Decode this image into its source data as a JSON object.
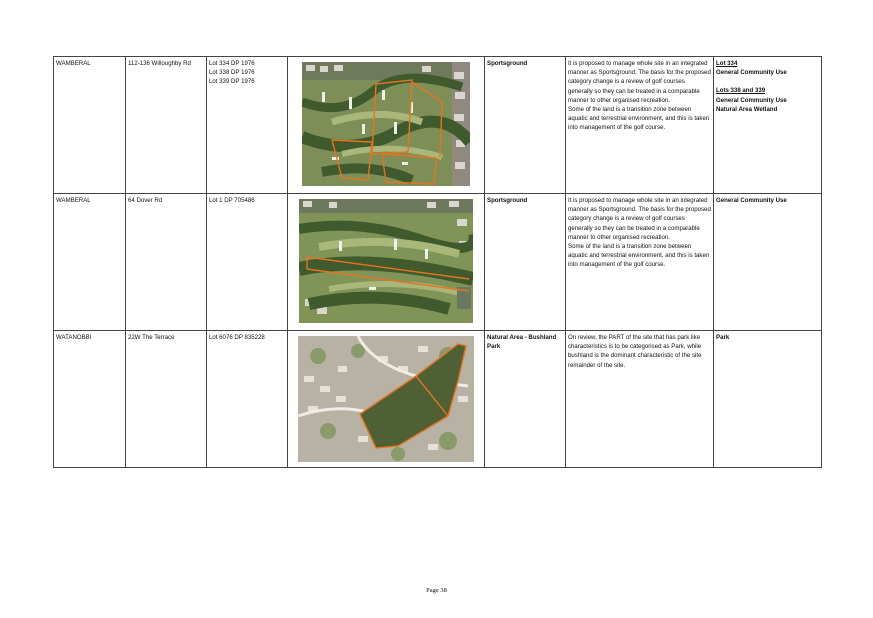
{
  "rows": [
    {
      "locality": "WAMBERAL",
      "address": "112-136 Willoughby Rd",
      "lots": [
        "Lot 334 DP 1976",
        "Lot 338 DP 1976",
        "Lot 339 DP 1976"
      ],
      "proposed_category": "Sportsground",
      "comment": "It is proposed to manage whole site in an integrated manner as Sportsground. The basis for the proposed category change is a review of golf courses generally so they can be treated in a comparable manner to other organised recreation.",
      "comment2": "Some of the land is a transition zone between aquatic and terrestrial environment, and this is taken into management of the golf course.",
      "category_groups": [
        {
          "heading": "Lot 334",
          "items": [
            "General Community Use"
          ]
        },
        {
          "heading": "Lots 338 and 339",
          "items": [
            "General Community Use",
            "Natural Area Wetland"
          ]
        }
      ]
    },
    {
      "locality": "WAMBERAL",
      "address": "64 Dover Rd",
      "lots": [
        "Lot 1 DP 705486"
      ],
      "proposed_category": "Sportsground",
      "comment": "It is proposed to manage whole site in an integrated manner as Sportsground. The basis for the proposed category change is a review of golf courses generally so they can be treated in a comparable manner to other organised recreation.",
      "comment2": "Some of the land is a transition zone between aquatic and terrestrial environment, and this is taken into management of the golf course.",
      "category": "General Community Use"
    },
    {
      "locality": "WATANOBBI",
      "address": "22W The Terrace",
      "lots": [
        "Lot 6076 DP 835228"
      ],
      "proposed_category": "Natural Area - Bushland Park",
      "comment": "On review, the PART of the site that has park like characteristics is to be categorised as Park, while bushland is the dominant characteristic of the site remainder of the site.",
      "category": "Park"
    }
  ],
  "colors": {
    "boundary": "#e8731e",
    "grass": "#8aa05a",
    "trees": "#3f5a2c",
    "roofs": "#d9d6cf"
  },
  "page": "Page 38"
}
